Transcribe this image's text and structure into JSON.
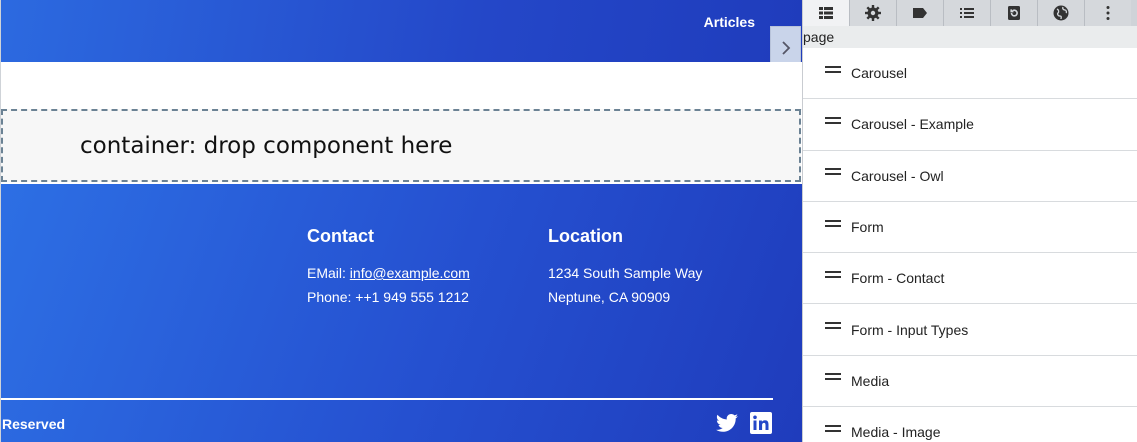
{
  "header": {
    "nav_link": "Articles"
  },
  "drop_zone": {
    "text": "container: drop component here"
  },
  "footer": {
    "contact": {
      "heading": "Contact",
      "email_label": "EMail: ",
      "email": "info@example.com",
      "phone": "Phone: ++1 949 555 1212"
    },
    "location": {
      "heading": "Location",
      "address_line1": "1234 South Sample Way",
      "address_line2": "Neptune, CA 90909"
    },
    "copyright": "Reserved"
  },
  "sidebar": {
    "toolbar": [
      "blocks-icon",
      "gear-icon",
      "tag-icon",
      "list-icon",
      "history-icon",
      "globe-icon",
      "more-vertical-icon"
    ],
    "breadcrumb": "page",
    "blocks": [
      "Carousel",
      "Carousel - Example",
      "Carousel - Owl",
      "Form",
      "Form - Contact",
      "Form - Input Types",
      "Media",
      "Media - Image"
    ]
  },
  "colors": {
    "brand_blue": "#2550d0",
    "sidebar_toolbar": "#cfd3d8"
  }
}
